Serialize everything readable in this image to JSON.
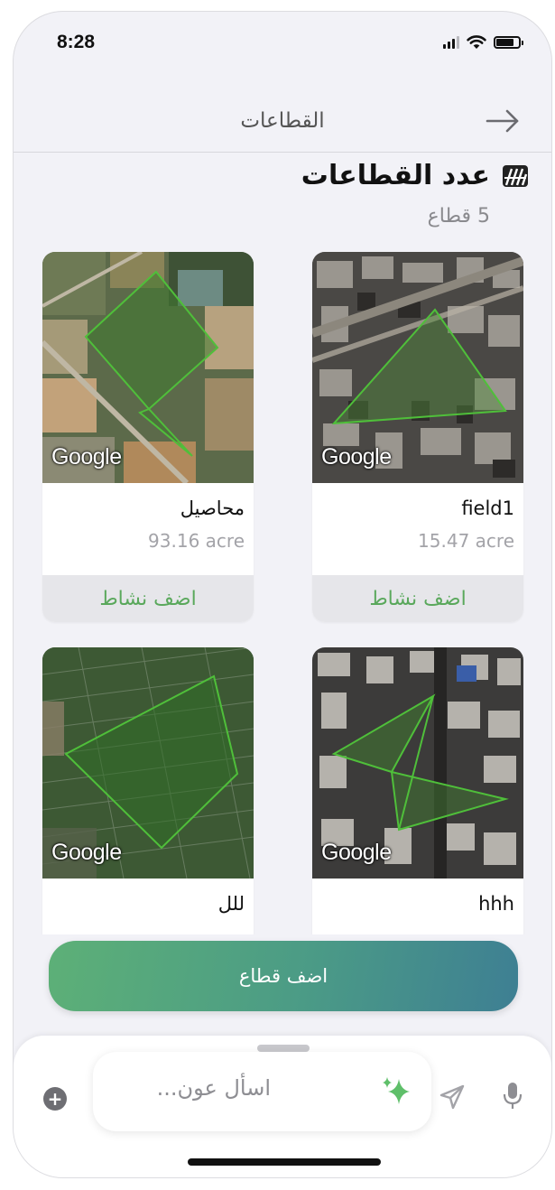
{
  "status_bar": {
    "time": "8:28"
  },
  "nav": {
    "title": "القطاعات",
    "back_icon": "arrow-right-icon"
  },
  "header": {
    "title": "عدد القطاعات",
    "count": "5 قطاع",
    "icon": "fields-icon"
  },
  "fields": [
    {
      "name": "field1",
      "area": "15.47 acre",
      "action": "اضف نشاط",
      "map_label": "Google"
    },
    {
      "name": "محاصيل",
      "area": "93.16 acre",
      "action": "اضف نشاط",
      "map_label": "Google"
    },
    {
      "name": "hhh",
      "map_label": "Google"
    },
    {
      "name": "للل",
      "map_label": "Google"
    }
  ],
  "add_sector_button": "اضف قطاع",
  "chat": {
    "placeholder": "اسأل عون...",
    "plus": "+"
  },
  "colors": {
    "accent_green": "#5aa85c",
    "button_start": "#5db077",
    "button_end": "#3e7f93"
  }
}
